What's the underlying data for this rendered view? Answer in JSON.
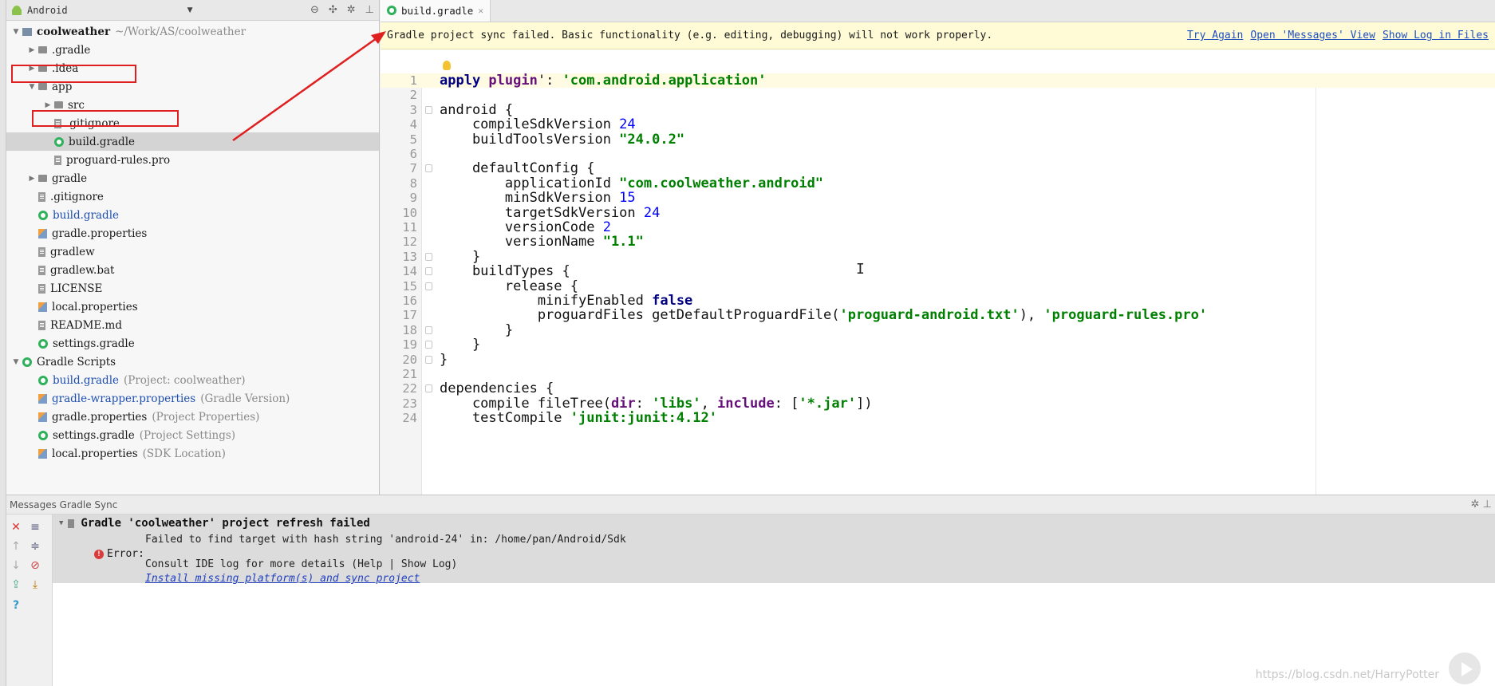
{
  "project": {
    "view_label": "Android",
    "tree": [
      {
        "label": "coolweather",
        "hint": "~/Work/AS/coolweather",
        "icon": "module",
        "arrow": "▼",
        "indent": 0,
        "bold": true
      },
      {
        "label": ".gradle",
        "icon": "folder",
        "arrow": "▶",
        "indent": 1
      },
      {
        "label": ".idea",
        "icon": "folder",
        "arrow": "▶",
        "indent": 1
      },
      {
        "label": "app",
        "icon": "folder",
        "arrow": "▼",
        "indent": 1
      },
      {
        "label": "src",
        "icon": "folder",
        "arrow": "▶",
        "indent": 2
      },
      {
        "label": ".gitignore",
        "icon": "file",
        "arrow": "",
        "indent": 2
      },
      {
        "label": "build.gradle",
        "icon": "gradle",
        "arrow": "",
        "indent": 2,
        "selected": true
      },
      {
        "label": "proguard-rules.pro",
        "icon": "file",
        "arrow": "",
        "indent": 2
      },
      {
        "label": "gradle",
        "icon": "folder",
        "arrow": "▶",
        "indent": 1
      },
      {
        "label": ".gitignore",
        "icon": "file",
        "arrow": "",
        "indent": 1
      },
      {
        "label": "build.gradle",
        "icon": "gradle",
        "arrow": "",
        "indent": 1,
        "blue": true
      },
      {
        "label": "gradle.properties",
        "icon": "props",
        "arrow": "",
        "indent": 1
      },
      {
        "label": "gradlew",
        "icon": "file",
        "arrow": "",
        "indent": 1
      },
      {
        "label": "gradlew.bat",
        "icon": "file",
        "arrow": "",
        "indent": 1
      },
      {
        "label": "LICENSE",
        "icon": "file",
        "arrow": "",
        "indent": 1
      },
      {
        "label": "local.properties",
        "icon": "props",
        "arrow": "",
        "indent": 1
      },
      {
        "label": "README.md",
        "icon": "file",
        "arrow": "",
        "indent": 1
      },
      {
        "label": "settings.gradle",
        "icon": "gradle",
        "arrow": "",
        "indent": 1
      },
      {
        "label": "Gradle Scripts",
        "icon": "gradle",
        "arrow": "▼",
        "indent": 0
      },
      {
        "label": "build.gradle",
        "hint": "(Project: coolweather)",
        "icon": "gradle",
        "arrow": "",
        "indent": 1,
        "blue": true
      },
      {
        "label": "gradle-wrapper.properties",
        "hint": "(Gradle Version)",
        "icon": "props",
        "arrow": "",
        "indent": 1,
        "blue": true
      },
      {
        "label": "gradle.properties",
        "hint": "(Project Properties)",
        "icon": "props",
        "arrow": "",
        "indent": 1
      },
      {
        "label": "settings.gradle",
        "hint": "(Project Settings)",
        "icon": "gradle",
        "arrow": "",
        "indent": 1
      },
      {
        "label": "local.properties",
        "hint": "(SDK Location)",
        "icon": "props",
        "arrow": "",
        "indent": 1
      }
    ]
  },
  "editor": {
    "tab_label": "build.gradle",
    "banner_message": "Gradle project sync failed. Basic functionality (e.g. editing, debugging) will not work properly.",
    "banner_links": [
      "Try Again",
      "Open 'Messages' View",
      "Show Log in Files"
    ],
    "lines": [
      [
        [
          "kw",
          "apply "
        ],
        [
          "named",
          "plugin"
        ],
        [
          "",
          "': "
        ],
        [
          "str",
          "'com.android.application'"
        ]
      ],
      [],
      [
        [
          "",
          "android {"
        ]
      ],
      [
        [
          "",
          "    compileSdkVersion "
        ],
        [
          "num",
          "24"
        ]
      ],
      [
        [
          "",
          "    buildToolsVersion "
        ],
        [
          "str",
          "\"24.0.2\""
        ]
      ],
      [],
      [
        [
          "",
          "    defaultConfig {"
        ]
      ],
      [
        [
          "",
          "        applicationId "
        ],
        [
          "str",
          "\"com.coolweather.android\""
        ]
      ],
      [
        [
          "",
          "        minSdkVersion "
        ],
        [
          "num",
          "15"
        ]
      ],
      [
        [
          "",
          "        targetSdkVersion "
        ],
        [
          "num",
          "24"
        ]
      ],
      [
        [
          "",
          "        versionCode "
        ],
        [
          "num",
          "2"
        ]
      ],
      [
        [
          "",
          "        versionName "
        ],
        [
          "str",
          "\"1.1\""
        ]
      ],
      [
        [
          "",
          "    }"
        ]
      ],
      [
        [
          "",
          "    buildTypes {"
        ]
      ],
      [
        [
          "",
          "        release {"
        ]
      ],
      [
        [
          "",
          "            minifyEnabled "
        ],
        [
          "kw",
          "false"
        ]
      ],
      [
        [
          "",
          "            proguardFiles getDefaultProguardFile("
        ],
        [
          "str",
          "'proguard-android.txt'"
        ],
        [
          "",
          "), "
        ],
        [
          "str",
          "'proguard-rules.pro'"
        ]
      ],
      [
        [
          "",
          "        }"
        ]
      ],
      [
        [
          "",
          "    }"
        ]
      ],
      [
        [
          "",
          "}"
        ]
      ],
      [],
      [
        [
          "",
          "dependencies {"
        ]
      ],
      [
        [
          "",
          "    compile fileTree("
        ],
        [
          "named",
          "dir"
        ],
        [
          "",
          ": "
        ],
        [
          "str",
          "'libs'"
        ],
        [
          "",
          ", "
        ],
        [
          "named",
          "include"
        ],
        [
          "",
          ": ["
        ],
        [
          "str",
          "'*.jar'"
        ],
        [
          "",
          "])"
        ]
      ],
      [
        [
          "",
          "    testCompile "
        ],
        [
          "str",
          "'junit:junit:4.12'"
        ]
      ]
    ]
  },
  "messages": {
    "header": "Messages Gradle Sync",
    "title": "Gradle 'coolweather' project refresh failed",
    "line1": "Failed to find target with hash string 'android-24' in: /home/pan/Android/Sdk",
    "error_label": "Error:",
    "line2": "Consult IDE log for more details (Help | Show Log)",
    "install_link": "Install missing platform(s) and sync project"
  },
  "watermark": "https://blog.csdn.net/HarryPotter"
}
